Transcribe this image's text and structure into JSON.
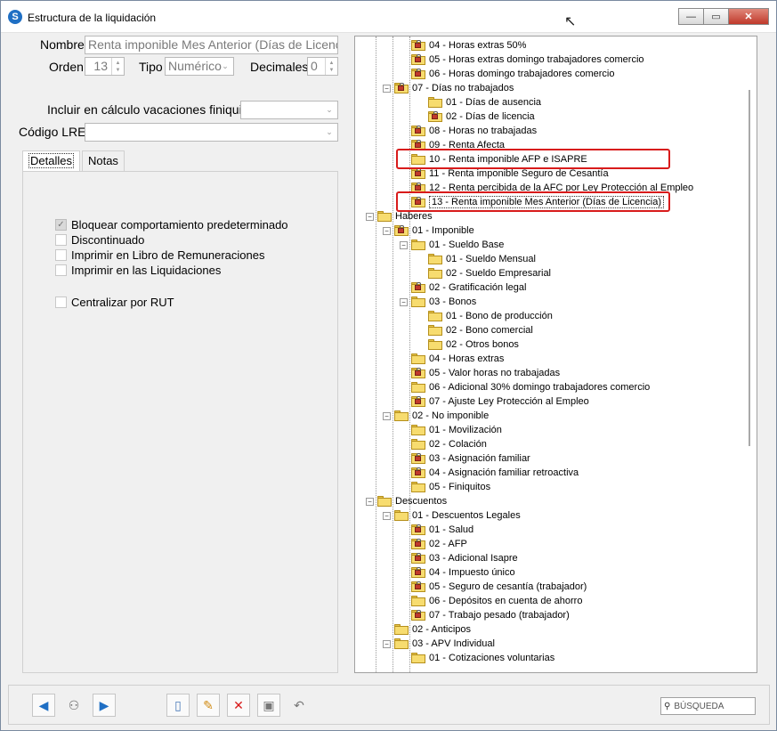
{
  "window": {
    "title": "Estructura de la liquidación",
    "buttons": {
      "minimize": "—",
      "maximize": "▭",
      "close": "✕"
    }
  },
  "form": {
    "nombre_label": "Nombre",
    "nombre_value": "Renta imponible Mes Anterior (Días de Licencia)",
    "orden_label": "Orden",
    "orden_value": "13",
    "tipo_label": "Tipo",
    "tipo_value": "Numérico",
    "decimales_label": "Decimales",
    "decimales_value": "0",
    "vacaciones_label": "Incluir en cálculo vacaciones finiquito",
    "vacaciones_value": "",
    "lre_label": "Código LRE",
    "lre_value": ""
  },
  "tabs": [
    "Detalles",
    "Notas"
  ],
  "checkboxes": [
    {
      "label": "Bloquear comportamiento predeterminado",
      "checked": true
    },
    {
      "label": "Discontinuado",
      "checked": false
    },
    {
      "label": "Imprimir en Libro de Remuneraciones",
      "checked": false
    },
    {
      "label": "Imprimir en las Liquidaciones",
      "checked": false
    },
    {
      "label": "Centralizar por RUT",
      "checked": false
    }
  ],
  "tree": [
    {
      "label": "04 - Horas extras 50%",
      "lock": true
    },
    {
      "label": "05 - Horas extras domingo trabajadores comercio",
      "lock": true
    },
    {
      "label": "06 - Horas domingo trabajadores comercio",
      "lock": true
    },
    {
      "label": "07 - Días no trabajados",
      "lock": true,
      "exp": "−"
    },
    {
      "label": "01 - Días de ausencia",
      "lock": false
    },
    {
      "label": "02 - Días de licencia",
      "lock": true
    },
    {
      "label": "08 - Horas no trabajadas",
      "lock": true
    },
    {
      "label": "09 - Renta Afecta",
      "lock": true
    },
    {
      "label": "10 - Renta imponible AFP e ISAPRE",
      "lock": false
    },
    {
      "label": "11 - Renta imponible Seguro de Cesantía",
      "lock": true
    },
    {
      "label": "12 - Renta percibida de la AFC por Ley Protección al Empleo",
      "lock": true
    },
    {
      "label": "13 - Renta imponible Mes Anterior (Días de Licencia)",
      "lock": true,
      "selected": true
    },
    {
      "label": "Haberes",
      "lock": false,
      "exp": "−"
    },
    {
      "label": "01 - Imponible",
      "lock": true,
      "exp": "−"
    },
    {
      "label": "01 - Sueldo Base",
      "lock": false,
      "exp": "−"
    },
    {
      "label": "01 - Sueldo Mensual",
      "lock": false
    },
    {
      "label": "02 - Sueldo Empresarial",
      "lock": false
    },
    {
      "label": "02 - Gratificación legal",
      "lock": true
    },
    {
      "label": "03 - Bonos",
      "lock": false,
      "exp": "−"
    },
    {
      "label": "01 - Bono de producción",
      "lock": false
    },
    {
      "label": "02 - Bono comercial",
      "lock": false
    },
    {
      "label": "02 - Otros bonos",
      "lock": false
    },
    {
      "label": "04 - Horas extras",
      "lock": false
    },
    {
      "label": "05 - Valor horas no trabajadas",
      "lock": true
    },
    {
      "label": "06 - Adicional 30% domingo trabajadores comercio",
      "lock": false
    },
    {
      "label": "07 - Ajuste Ley Protección al Empleo",
      "lock": true
    },
    {
      "label": "02 - No imponible",
      "lock": false,
      "exp": "−"
    },
    {
      "label": "01 - Movilización",
      "lock": false
    },
    {
      "label": "02 - Colación",
      "lock": false
    },
    {
      "label": "03 - Asignación familiar",
      "lock": true
    },
    {
      "label": "04 - Asignación familiar retroactiva",
      "lock": true
    },
    {
      "label": "05 - Finiquitos",
      "lock": false
    },
    {
      "label": "Descuentos",
      "lock": false,
      "exp": "−"
    },
    {
      "label": "01 - Descuentos Legales",
      "lock": false,
      "exp": "−"
    },
    {
      "label": "01 - Salud",
      "lock": true
    },
    {
      "label": "02 - AFP",
      "lock": true
    },
    {
      "label": "03 - Adicional Isapre",
      "lock": true
    },
    {
      "label": "04 - Impuesto único",
      "lock": true
    },
    {
      "label": "05 - Seguro de cesantía (trabajador)",
      "lock": true
    },
    {
      "label": "06 - Depósitos en cuenta de ahorro",
      "lock": false
    },
    {
      "label": "07 - Trabajo pesado (trabajador)",
      "lock": true
    },
    {
      "label": "02 - Anticipos",
      "lock": false
    },
    {
      "label": "03 - APV Individual",
      "lock": false,
      "exp": "−"
    },
    {
      "label": "01 - Cotizaciones voluntarias",
      "lock": false
    }
  ],
  "toolbar": {
    "search_label": "BÚSQUEDA",
    "icons": [
      "arrow-left-icon",
      "binoculars-icon",
      "arrow-right-icon",
      "new-document-icon",
      "edit-pencil-icon",
      "delete-x-icon",
      "save-disk-icon",
      "undo-icon"
    ]
  },
  "colors": {
    "highlight": "#d81b1b",
    "accent": "#1f6fc4"
  }
}
